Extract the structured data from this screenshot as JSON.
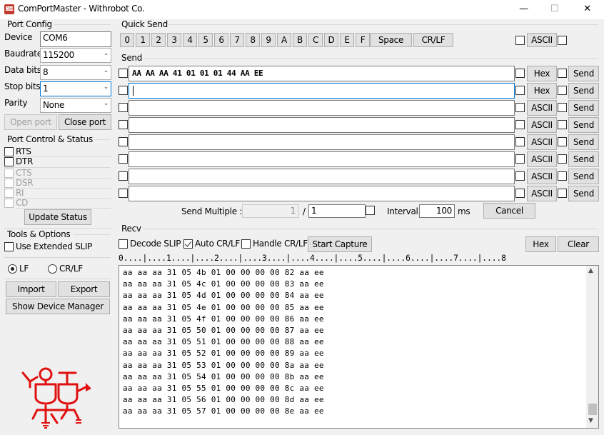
{
  "window": {
    "title": "ComPortMaster - Withrobot Co.",
    "minimize": "—",
    "maximize": "☐",
    "close": "✕"
  },
  "port_config": {
    "title": "Port Config",
    "device_label": "Device",
    "device_value": "COM6",
    "baudrate_label": "Baudrate",
    "baudrate_value": "115200",
    "databits_label": "Data bits",
    "databits_value": "8",
    "stopbits_label": "Stop bits",
    "stopbits_value": "1",
    "parity_label": "Parity",
    "parity_value": "None",
    "open_port": "Open port",
    "close_port": "Close port"
  },
  "port_control": {
    "title": "Port Control & Status",
    "rts": "RTS",
    "dtr": "DTR",
    "cts": "CTS",
    "dsr": "DSR",
    "ri": "RI",
    "cd": "CD",
    "update_status": "Update Status"
  },
  "tools": {
    "title": "Tools & Options",
    "use_extended_slip": "Use Extended SLIP",
    "lf": "LF",
    "crlf": "CR/LF",
    "import": "Import",
    "export": "Export",
    "show_device_manager": "Show Device Manager"
  },
  "quick_send": {
    "title": "Quick Send",
    "keys": [
      "0",
      "1",
      "2",
      "3",
      "4",
      "5",
      "6",
      "7",
      "8",
      "9",
      "A",
      "B",
      "C",
      "D",
      "E",
      "F"
    ],
    "space": "Space",
    "crlf": "CR/LF",
    "ascii": "ASCII"
  },
  "send": {
    "title": "Send",
    "rows": [
      {
        "value": "AA AA AA 41 01 01 01 44 AA EE",
        "mode": "Hex",
        "send": "Send"
      },
      {
        "value": "",
        "mode": "Hex",
        "send": "Send"
      },
      {
        "value": "",
        "mode": "ASCII",
        "send": "Send"
      },
      {
        "value": "",
        "mode": "ASCII",
        "send": "Send"
      },
      {
        "value": "",
        "mode": "ASCII",
        "send": "Send"
      },
      {
        "value": "",
        "mode": "ASCII",
        "send": "Send"
      },
      {
        "value": "",
        "mode": "ASCII",
        "send": "Send"
      },
      {
        "value": "",
        "mode": "ASCII",
        "send": "Send"
      }
    ],
    "send_multiple_label": "Send Multiple :",
    "send_multiple_count": "1",
    "slash": "/",
    "send_multiple_total": "1",
    "interval_label": "Interval",
    "interval_value": "100",
    "interval_unit": "ms",
    "cancel": "Cancel"
  },
  "recv": {
    "title": "Recv",
    "decode_slip": "Decode SLIP",
    "auto_crlf": "Auto CR/LF",
    "handle_crlf": "Handle CR/LF",
    "start_capture": "Start Capture",
    "hex": "Hex",
    "clear": "Clear",
    "ruler": "0....|....1....|....2....|....3....|....4....|....5....|....6....|....7....|....8",
    "lines": [
      "aa aa aa 31 05 4b 01 00 00 00 00 82 aa ee",
      "aa aa aa 31 05 4c 01 00 00 00 00 83 aa ee",
      "aa aa aa 31 05 4d 01 00 00 00 00 84 aa ee",
      "aa aa aa 31 05 4e 01 00 00 00 00 85 aa ee",
      "aa aa aa 31 05 4f 01 00 00 00 00 86 aa ee",
      "aa aa aa 31 05 50 01 00 00 00 00 87 aa ee",
      "aa aa aa 31 05 51 01 00 00 00 00 88 aa ee",
      "aa aa aa 31 05 52 01 00 00 00 00 89 aa ee",
      "aa aa aa 31 05 53 01 00 00 00 00 8a aa ee",
      "aa aa aa 31 05 54 01 00 00 00 00 8b aa ee",
      "aa aa aa 31 05 55 01 00 00 00 00 8c aa ee",
      "aa aa aa 31 05 56 01 00 00 00 00 8d aa ee",
      "aa aa aa 31 05 57 01 00 00 00 00 8e aa ee"
    ],
    "scroll_up": "▲",
    "scroll_down": "▼"
  },
  "colors": {
    "accent": "#0078d7",
    "logo_red": "#e01010"
  },
  "icons": {
    "app": "comport-app-icon",
    "logo": "withrobot-logo"
  }
}
